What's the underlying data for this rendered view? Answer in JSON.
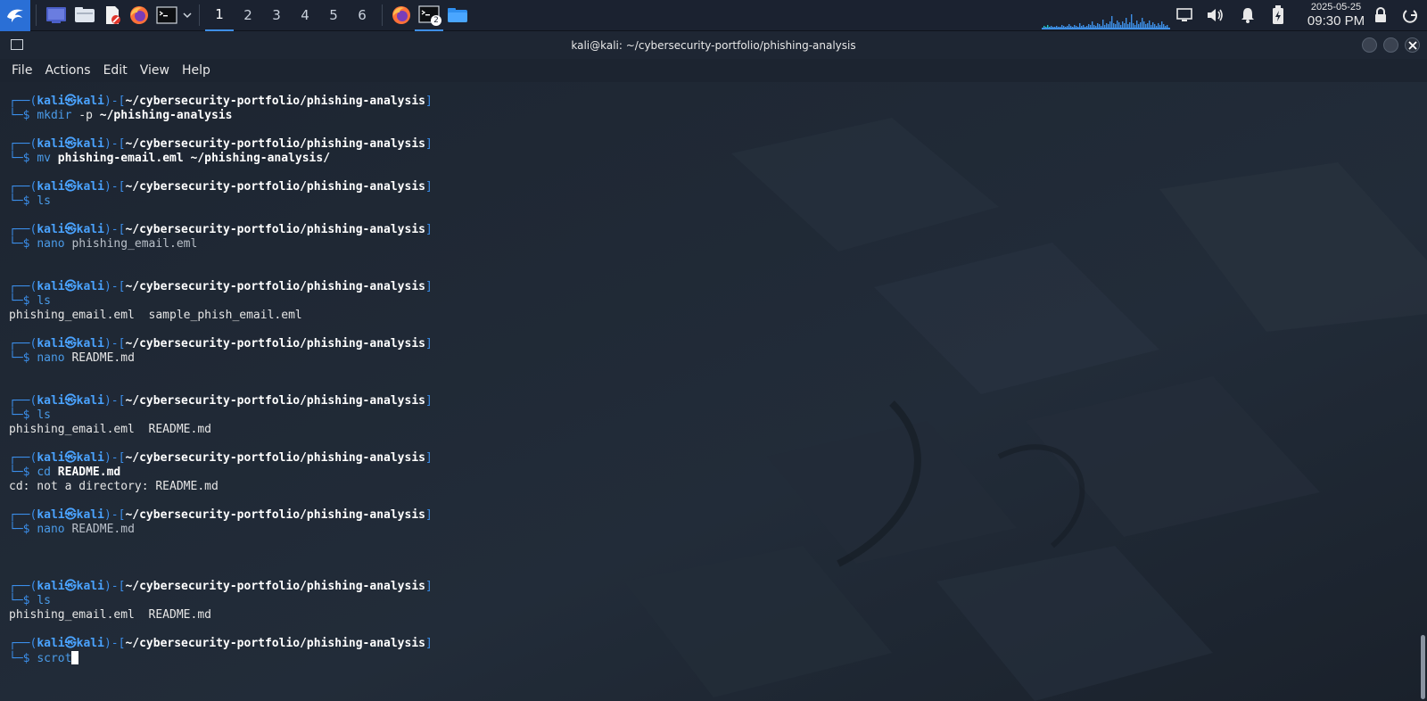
{
  "panel": {
    "launchers": [
      {
        "name": "kali-menu",
        "icon": "kali-dragon-icon"
      },
      {
        "name": "show-desktop",
        "icon": "desktop-icon"
      },
      {
        "name": "file-manager",
        "icon": "folder-icon"
      },
      {
        "name": "text-editor",
        "icon": "text-editor-icon"
      },
      {
        "name": "firefox",
        "icon": "firefox-icon"
      },
      {
        "name": "terminal",
        "icon": "terminal-icon"
      }
    ],
    "workspaces": [
      "1",
      "2",
      "3",
      "4",
      "5",
      "6"
    ],
    "active_workspace": "1",
    "task_badge": "2",
    "clock_date": "2025-05-25",
    "clock_time": "09:30 PM",
    "accent": "#3e8fe6"
  },
  "window": {
    "title": "kali@kali: ~/cybersecurity-portfolio/phishing-analysis"
  },
  "menubar": {
    "items": [
      "File",
      "Actions",
      "Edit",
      "View",
      "Help"
    ]
  },
  "terminal": {
    "prompt_user": "kali",
    "prompt_host": "kali",
    "prompt_path": "~/cybersecurity-portfolio/phishing-analysis",
    "entries": [
      {
        "cmd": "mkdir",
        "args": [
          {
            "t": " -p ",
            "s": "arg"
          },
          {
            "t": "~/phishing-analysis",
            "s": "argb"
          }
        ],
        "output": []
      },
      {
        "cmd": "mv",
        "args": [
          {
            "t": " ",
            "s": "arg"
          },
          {
            "t": "phishing-email.eml ~/phishing-analysis/",
            "s": "argb"
          }
        ],
        "output": []
      },
      {
        "cmd": "ls",
        "args": [],
        "output": []
      },
      {
        "cmd": "nano",
        "args": [
          {
            "t": " phishing_email.eml",
            "s": "argd"
          }
        ],
        "output": [
          ""
        ]
      },
      {
        "cmd": "ls",
        "args": [],
        "output": [
          "phishing_email.eml  sample_phish_email.eml"
        ]
      },
      {
        "cmd": "nano",
        "args": [
          {
            "t": " README.md",
            "s": "arg"
          }
        ],
        "output": [
          ""
        ]
      },
      {
        "cmd": "ls",
        "args": [],
        "output": [
          "phishing_email.eml  README.md"
        ]
      },
      {
        "cmd": "cd",
        "args": [
          {
            "t": " ",
            "s": "arg"
          },
          {
            "t": "README.md",
            "s": "argb"
          }
        ],
        "output": [
          "cd: not a directory: README.md"
        ]
      },
      {
        "cmd": "nano",
        "args": [
          {
            "t": " ",
            "s": "arg"
          },
          {
            "t": "README.md",
            "s": "argd"
          }
        ],
        "output": [
          "",
          ""
        ]
      },
      {
        "cmd": "ls",
        "args": [],
        "output": [
          "phishing_email.eml  README.md"
        ]
      },
      {
        "cmd": "scrot",
        "args": [],
        "output": [],
        "cursor": true
      }
    ]
  },
  "colors": {
    "prompt_blue": "#3b8eea",
    "command_blue": "#4a9be8",
    "background": "#1c2430"
  }
}
